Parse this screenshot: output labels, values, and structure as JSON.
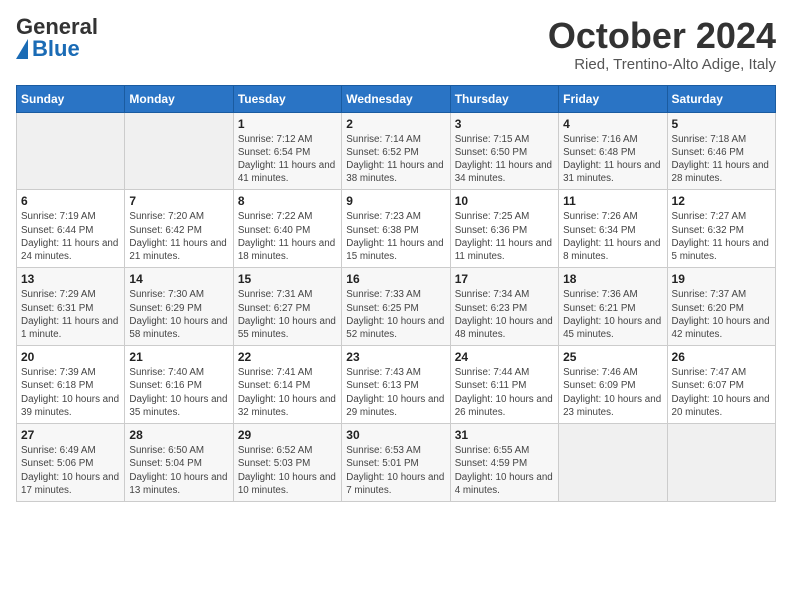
{
  "header": {
    "logo_general": "General",
    "logo_blue": "Blue",
    "month_title": "October 2024",
    "location": "Ried, Trentino-Alto Adige, Italy"
  },
  "weekdays": [
    "Sunday",
    "Monday",
    "Tuesday",
    "Wednesday",
    "Thursday",
    "Friday",
    "Saturday"
  ],
  "weeks": [
    [
      {
        "day": "",
        "sunrise": "",
        "sunset": "",
        "daylight": ""
      },
      {
        "day": "",
        "sunrise": "",
        "sunset": "",
        "daylight": ""
      },
      {
        "day": "1",
        "sunrise": "Sunrise: 7:12 AM",
        "sunset": "Sunset: 6:54 PM",
        "daylight": "Daylight: 11 hours and 41 minutes."
      },
      {
        "day": "2",
        "sunrise": "Sunrise: 7:14 AM",
        "sunset": "Sunset: 6:52 PM",
        "daylight": "Daylight: 11 hours and 38 minutes."
      },
      {
        "day": "3",
        "sunrise": "Sunrise: 7:15 AM",
        "sunset": "Sunset: 6:50 PM",
        "daylight": "Daylight: 11 hours and 34 minutes."
      },
      {
        "day": "4",
        "sunrise": "Sunrise: 7:16 AM",
        "sunset": "Sunset: 6:48 PM",
        "daylight": "Daylight: 11 hours and 31 minutes."
      },
      {
        "day": "5",
        "sunrise": "Sunrise: 7:18 AM",
        "sunset": "Sunset: 6:46 PM",
        "daylight": "Daylight: 11 hours and 28 minutes."
      }
    ],
    [
      {
        "day": "6",
        "sunrise": "Sunrise: 7:19 AM",
        "sunset": "Sunset: 6:44 PM",
        "daylight": "Daylight: 11 hours and 24 minutes."
      },
      {
        "day": "7",
        "sunrise": "Sunrise: 7:20 AM",
        "sunset": "Sunset: 6:42 PM",
        "daylight": "Daylight: 11 hours and 21 minutes."
      },
      {
        "day": "8",
        "sunrise": "Sunrise: 7:22 AM",
        "sunset": "Sunset: 6:40 PM",
        "daylight": "Daylight: 11 hours and 18 minutes."
      },
      {
        "day": "9",
        "sunrise": "Sunrise: 7:23 AM",
        "sunset": "Sunset: 6:38 PM",
        "daylight": "Daylight: 11 hours and 15 minutes."
      },
      {
        "day": "10",
        "sunrise": "Sunrise: 7:25 AM",
        "sunset": "Sunset: 6:36 PM",
        "daylight": "Daylight: 11 hours and 11 minutes."
      },
      {
        "day": "11",
        "sunrise": "Sunrise: 7:26 AM",
        "sunset": "Sunset: 6:34 PM",
        "daylight": "Daylight: 11 hours and 8 minutes."
      },
      {
        "day": "12",
        "sunrise": "Sunrise: 7:27 AM",
        "sunset": "Sunset: 6:32 PM",
        "daylight": "Daylight: 11 hours and 5 minutes."
      }
    ],
    [
      {
        "day": "13",
        "sunrise": "Sunrise: 7:29 AM",
        "sunset": "Sunset: 6:31 PM",
        "daylight": "Daylight: 11 hours and 1 minute."
      },
      {
        "day": "14",
        "sunrise": "Sunrise: 7:30 AM",
        "sunset": "Sunset: 6:29 PM",
        "daylight": "Daylight: 10 hours and 58 minutes."
      },
      {
        "day": "15",
        "sunrise": "Sunrise: 7:31 AM",
        "sunset": "Sunset: 6:27 PM",
        "daylight": "Daylight: 10 hours and 55 minutes."
      },
      {
        "day": "16",
        "sunrise": "Sunrise: 7:33 AM",
        "sunset": "Sunset: 6:25 PM",
        "daylight": "Daylight: 10 hours and 52 minutes."
      },
      {
        "day": "17",
        "sunrise": "Sunrise: 7:34 AM",
        "sunset": "Sunset: 6:23 PM",
        "daylight": "Daylight: 10 hours and 48 minutes."
      },
      {
        "day": "18",
        "sunrise": "Sunrise: 7:36 AM",
        "sunset": "Sunset: 6:21 PM",
        "daylight": "Daylight: 10 hours and 45 minutes."
      },
      {
        "day": "19",
        "sunrise": "Sunrise: 7:37 AM",
        "sunset": "Sunset: 6:20 PM",
        "daylight": "Daylight: 10 hours and 42 minutes."
      }
    ],
    [
      {
        "day": "20",
        "sunrise": "Sunrise: 7:39 AM",
        "sunset": "Sunset: 6:18 PM",
        "daylight": "Daylight: 10 hours and 39 minutes."
      },
      {
        "day": "21",
        "sunrise": "Sunrise: 7:40 AM",
        "sunset": "Sunset: 6:16 PM",
        "daylight": "Daylight: 10 hours and 35 minutes."
      },
      {
        "day": "22",
        "sunrise": "Sunrise: 7:41 AM",
        "sunset": "Sunset: 6:14 PM",
        "daylight": "Daylight: 10 hours and 32 minutes."
      },
      {
        "day": "23",
        "sunrise": "Sunrise: 7:43 AM",
        "sunset": "Sunset: 6:13 PM",
        "daylight": "Daylight: 10 hours and 29 minutes."
      },
      {
        "day": "24",
        "sunrise": "Sunrise: 7:44 AM",
        "sunset": "Sunset: 6:11 PM",
        "daylight": "Daylight: 10 hours and 26 minutes."
      },
      {
        "day": "25",
        "sunrise": "Sunrise: 7:46 AM",
        "sunset": "Sunset: 6:09 PM",
        "daylight": "Daylight: 10 hours and 23 minutes."
      },
      {
        "day": "26",
        "sunrise": "Sunrise: 7:47 AM",
        "sunset": "Sunset: 6:07 PM",
        "daylight": "Daylight: 10 hours and 20 minutes."
      }
    ],
    [
      {
        "day": "27",
        "sunrise": "Sunrise: 6:49 AM",
        "sunset": "Sunset: 5:06 PM",
        "daylight": "Daylight: 10 hours and 17 minutes."
      },
      {
        "day": "28",
        "sunrise": "Sunrise: 6:50 AM",
        "sunset": "Sunset: 5:04 PM",
        "daylight": "Daylight: 10 hours and 13 minutes."
      },
      {
        "day": "29",
        "sunrise": "Sunrise: 6:52 AM",
        "sunset": "Sunset: 5:03 PM",
        "daylight": "Daylight: 10 hours and 10 minutes."
      },
      {
        "day": "30",
        "sunrise": "Sunrise: 6:53 AM",
        "sunset": "Sunset: 5:01 PM",
        "daylight": "Daylight: 10 hours and 7 minutes."
      },
      {
        "day": "31",
        "sunrise": "Sunrise: 6:55 AM",
        "sunset": "Sunset: 4:59 PM",
        "daylight": "Daylight: 10 hours and 4 minutes."
      },
      {
        "day": "",
        "sunrise": "",
        "sunset": "",
        "daylight": ""
      },
      {
        "day": "",
        "sunrise": "",
        "sunset": "",
        "daylight": ""
      }
    ]
  ]
}
